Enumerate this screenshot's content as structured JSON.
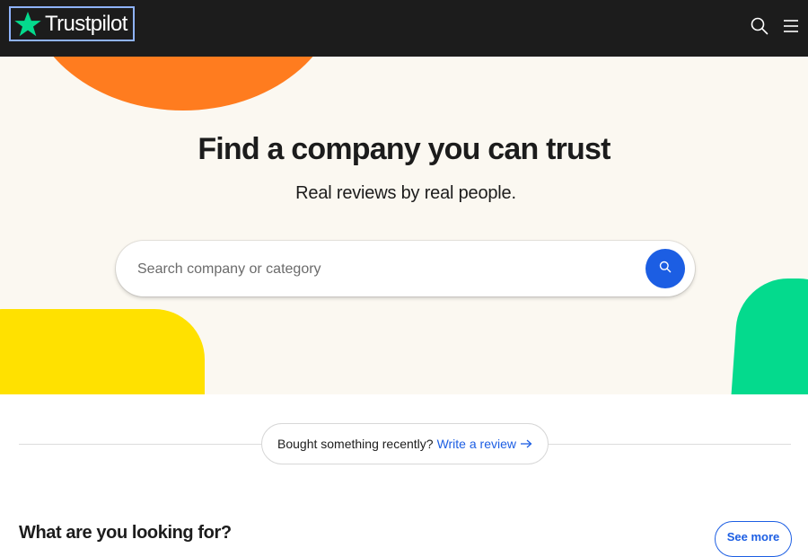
{
  "header": {
    "logo_text": "Trustpilot",
    "logo_icon": "star-icon",
    "search_icon": "search-icon",
    "menu_icon": "hamburger-menu-icon"
  },
  "hero": {
    "title": "Find a company you can trust",
    "subtitle": "Real reviews by real people.",
    "search": {
      "placeholder": "Search company or category",
      "value": "",
      "button_icon": "search-icon"
    }
  },
  "review_prompt": {
    "text": "Bought something recently?",
    "link_label": "Write a review",
    "link_icon": "arrow-right-icon"
  },
  "categories_section": {
    "title": "What are you looking for?",
    "see_more_label": "See more"
  },
  "colors": {
    "brand_green": "#04da8d",
    "header_bg": "#1c1c1c",
    "hero_bg": "#fbf8f1",
    "accent_blue": "#1c5ee3",
    "orange": "#ff7c1f",
    "yellow": "#ffe100"
  }
}
